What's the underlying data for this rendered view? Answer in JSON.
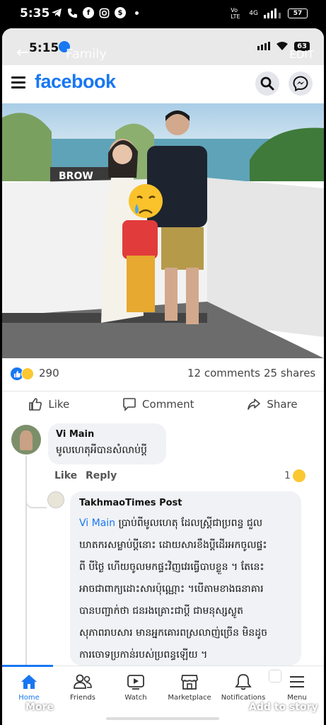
{
  "status_bar": {
    "time": "5:35",
    "battery": "57",
    "network": "Vo LTE",
    "signal": "4G"
  },
  "story_overlay": {
    "inner_time": "5:15",
    "title": "Family",
    "edit": "EDIT",
    "inner_battery": "63",
    "more": "More",
    "add_to_story": "Add to story"
  },
  "header": {
    "brand": "facebook"
  },
  "post": {
    "reaction_count": "290",
    "comments": "12 comments",
    "shares": "25 shares",
    "like": "Like",
    "comment": "Comment",
    "share": "Share",
    "photo_sign": "BROW"
  },
  "comment1": {
    "author": "Vi Main",
    "text": "មូលហេតុអីបានសំលាប់ប្ដី",
    "like": "Like",
    "reply": "Reply",
    "reaction_count": "1"
  },
  "reply1": {
    "author": "TakhmaoTimes Post",
    "mention": "Vi Main",
    "lines": [
      " ប្រាប់ពីមូលហេតុ ដែលស្ត្រីជាប្រពន្ធ ជួល",
      "ឃាតករសម្លាប់ប្ដីនោះ ដោយសារខឹងប្ដីដើរអកចូលផ្ទះ",
      "ពី បីថ្ងៃ ហើយចូលមកផ្ទះវិញវេរធ្វើបាបខ្លួន ។ តែនេះ",
      "អាចជាពាក្យដោះសារប៉ុណ្ណោះ ។បើតាមខាងធនាគារ",
      "បានបញ្ជាក់ថា ជនរងគ្រោះជាប្ដី ជាមនុស្សស្លូត",
      "សុភាពរាបសារ មានអ្នកគោរពស្រលាញ់ច្រើន មិនដូច",
      "ការចោទប្រកាន់របស់ប្រពន្ធឡើយ ។"
    ]
  },
  "nav": {
    "home": "Home",
    "friends": "Friends",
    "watch": "Watch",
    "marketplace": "Marketplace",
    "notifications": "Notifications",
    "menu": "Menu"
  },
  "colors": {
    "brand": "#1877f2",
    "bg": "#ffffff",
    "bubble": "#f0f2f5"
  }
}
